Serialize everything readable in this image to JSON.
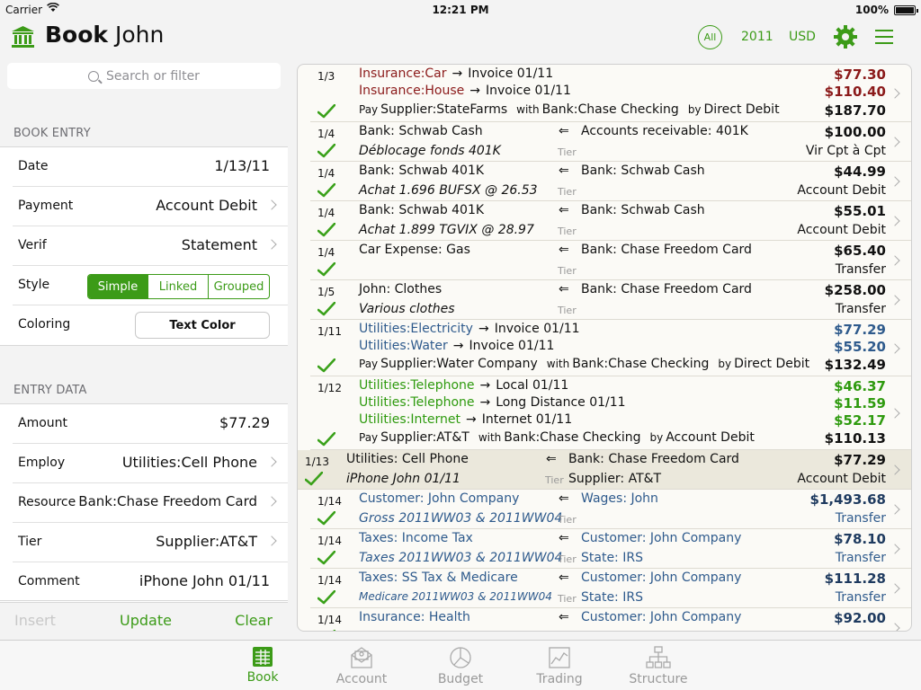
{
  "status": {
    "carrier": "Carrier",
    "time": "12:21 PM",
    "battery": "100%"
  },
  "header": {
    "title_bold": "Book",
    "title_rest": " John",
    "filter_all": "All",
    "year": "2011",
    "currency": "USD",
    "accent": "#3c9b18"
  },
  "search": {
    "placeholder": "Search or filter"
  },
  "book_entry": {
    "header": "BOOK ENTRY",
    "date_label": "Date",
    "date_value": "1/13/11",
    "payment_label": "Payment",
    "payment_value": "Account Debit",
    "verif_label": "Verif",
    "verif_value": "Statement",
    "style_label": "Style",
    "style_options": [
      "Simple",
      "Linked",
      "Grouped"
    ],
    "style_selected": "Simple",
    "coloring_label": "Coloring",
    "coloring_button": "Text Color"
  },
  "entry_data": {
    "header": "ENTRY DATA",
    "amount_label": "Amount",
    "amount_value": "$77.29",
    "employ_label": "Employ",
    "employ_value": "Utilities:Cell Phone",
    "resource_label": "Resource",
    "resource_value": "Bank:Chase Freedom Card",
    "tier_label": "Tier",
    "tier_value": "Supplier:AT&T",
    "comment_label": "Comment",
    "comment_value": "iPhone John 01/11"
  },
  "actions": {
    "insert": "Insert",
    "update": "Update",
    "clear": "Clear"
  },
  "entries": [
    {
      "date": "1/3",
      "date_color": "red",
      "height": 64,
      "verified": true,
      "splits": [
        {
          "account": "Insurance:Car",
          "sub": "Invoice 01/11",
          "amount": "$77.30",
          "color": "red"
        },
        {
          "account": "Insurance:House",
          "sub": "Invoice 01/11",
          "amount": "$110.40",
          "color": "red"
        }
      ],
      "pay": {
        "prefix": "Pay",
        "payee": "Supplier:StateFarms",
        "with": "with",
        "bank": "Bank:Chase Checking",
        "by": "by",
        "method": "Direct Debit",
        "total": "$187.70"
      }
    },
    {
      "date": "1/4",
      "height": 44,
      "verified": true,
      "color": "dark",
      "account": "Bank: Schwab Cash",
      "contra": "Accounts receivable: 401K",
      "amount": "$100.00",
      "desc": "Déblocage fonds 401K",
      "tier": "Tier",
      "method": "Vir Cpt à Cpt"
    },
    {
      "date": "1/4",
      "height": 44,
      "verified": true,
      "color": "dark",
      "account": "Bank: Schwab 401K",
      "contra": "Bank: Schwab Cash",
      "amount": "$44.99",
      "desc": "Achat 1.696 BUFSX @ 26.53",
      "tier": "Tier",
      "method": "Account Debit"
    },
    {
      "date": "1/4",
      "height": 44,
      "verified": true,
      "color": "dark",
      "account": "Bank: Schwab 401K",
      "contra": "Bank: Schwab Cash",
      "amount": "$55.01",
      "desc": "Achat 1.899 TGVIX @ 28.97",
      "tier": "Tier",
      "method": "Account Debit"
    },
    {
      "date": "1/4",
      "height": 44,
      "verified": true,
      "color": "dark",
      "account": "Car Expense: Gas",
      "contra": "Bank: Chase Freedom Card",
      "amount": "$65.40",
      "desc": "",
      "tier": "Tier",
      "method": "Transfer"
    },
    {
      "date": "1/5",
      "height": 44,
      "verified": true,
      "color": "dark",
      "account": "John: Clothes",
      "contra": "Bank: Chase Freedom Card",
      "amount": "$258.00",
      "desc": "Various clothes",
      "tier": "Tier",
      "method": "Transfer"
    },
    {
      "date": "1/11",
      "date_color": "blue",
      "height": 63,
      "verified": true,
      "splits": [
        {
          "account": "Utilities:Electricity",
          "sub": "Invoice 01/11",
          "amount": "$77.29",
          "color": "blue"
        },
        {
          "account": "Utilities:Water",
          "sub": "Invoice 01/11",
          "amount": "$55.20",
          "color": "blue"
        }
      ],
      "pay": {
        "prefix": "Pay",
        "payee": "Supplier:Water Company",
        "with": "with",
        "bank": "Bank:Chase Checking",
        "by": "by",
        "method": "Direct Debit",
        "total": "$132.49"
      }
    },
    {
      "date": "1/12",
      "date_color": "green",
      "height": 82,
      "verified": true,
      "splits": [
        {
          "account": "Utilities:Telephone",
          "sub": "Local 01/11",
          "amount": "$46.37",
          "color": "green"
        },
        {
          "account": "Utilities:Telephone",
          "sub": "Long Distance 01/11",
          "amount": "$11.59",
          "color": "green"
        },
        {
          "account": "Utilities:Internet",
          "sub": "Internet 01/11",
          "amount": "$52.17",
          "color": "green"
        }
      ],
      "pay": {
        "prefix": "Pay",
        "payee": "Supplier:AT&T",
        "with": "with",
        "bank": "Bank:Chase Checking",
        "by": "by",
        "method": "Account Debit",
        "total": "$110.13"
      }
    },
    {
      "date": "1/13",
      "height": 44,
      "verified": true,
      "color": "dark",
      "selected": true,
      "account": "Utilities: Cell Phone",
      "contra": "Bank: Chase Freedom Card",
      "amount": "$77.29",
      "desc": "iPhone John 01/11",
      "tier": "Tier",
      "tier_value": "Supplier: AT&T",
      "method": "Account Debit"
    },
    {
      "date": "1/14",
      "height": 44,
      "verified": true,
      "color": "blue",
      "account": "Customer: John Company",
      "contra": "Wages: John",
      "amount": "$1,493.68",
      "desc": "Gross 2011WW03 & 2011WW04",
      "tier": "Tier",
      "method": "Transfer"
    },
    {
      "date": "1/14",
      "height": 44,
      "verified": true,
      "color": "blue",
      "account": "Taxes: Income Tax",
      "contra": "Customer: John Company",
      "amount": "$78.10",
      "desc": "Taxes 2011WW03 & 2011WW04",
      "tier": "Tier",
      "tier_value": "State: IRS",
      "method": "Transfer"
    },
    {
      "date": "1/14",
      "height": 44,
      "verified": true,
      "color": "blue",
      "account": "Taxes: SS Tax & Medicare",
      "contra": "Customer: John Company",
      "amount": "$111.28",
      "desc": "Medicare 2011WW03 & 2011WW04",
      "desc_small": true,
      "tier": "Tier",
      "tier_value": "State: IRS",
      "method": "Transfer"
    },
    {
      "date": "1/14",
      "height": 44,
      "verified": true,
      "color": "blue",
      "account": "Insurance: Health",
      "contra": "Customer: John Company",
      "amount": "$92.00",
      "desc": "",
      "tier": "",
      "method": ""
    }
  ],
  "tabs": [
    {
      "label": "Book",
      "icon": "book-icon",
      "active": true
    },
    {
      "label": "Account",
      "icon": "account-icon",
      "active": false
    },
    {
      "label": "Budget",
      "icon": "budget-icon",
      "active": false
    },
    {
      "label": "Trading",
      "icon": "trading-icon",
      "active": false
    },
    {
      "label": "Structure",
      "icon": "structure-icon",
      "active": false
    }
  ]
}
